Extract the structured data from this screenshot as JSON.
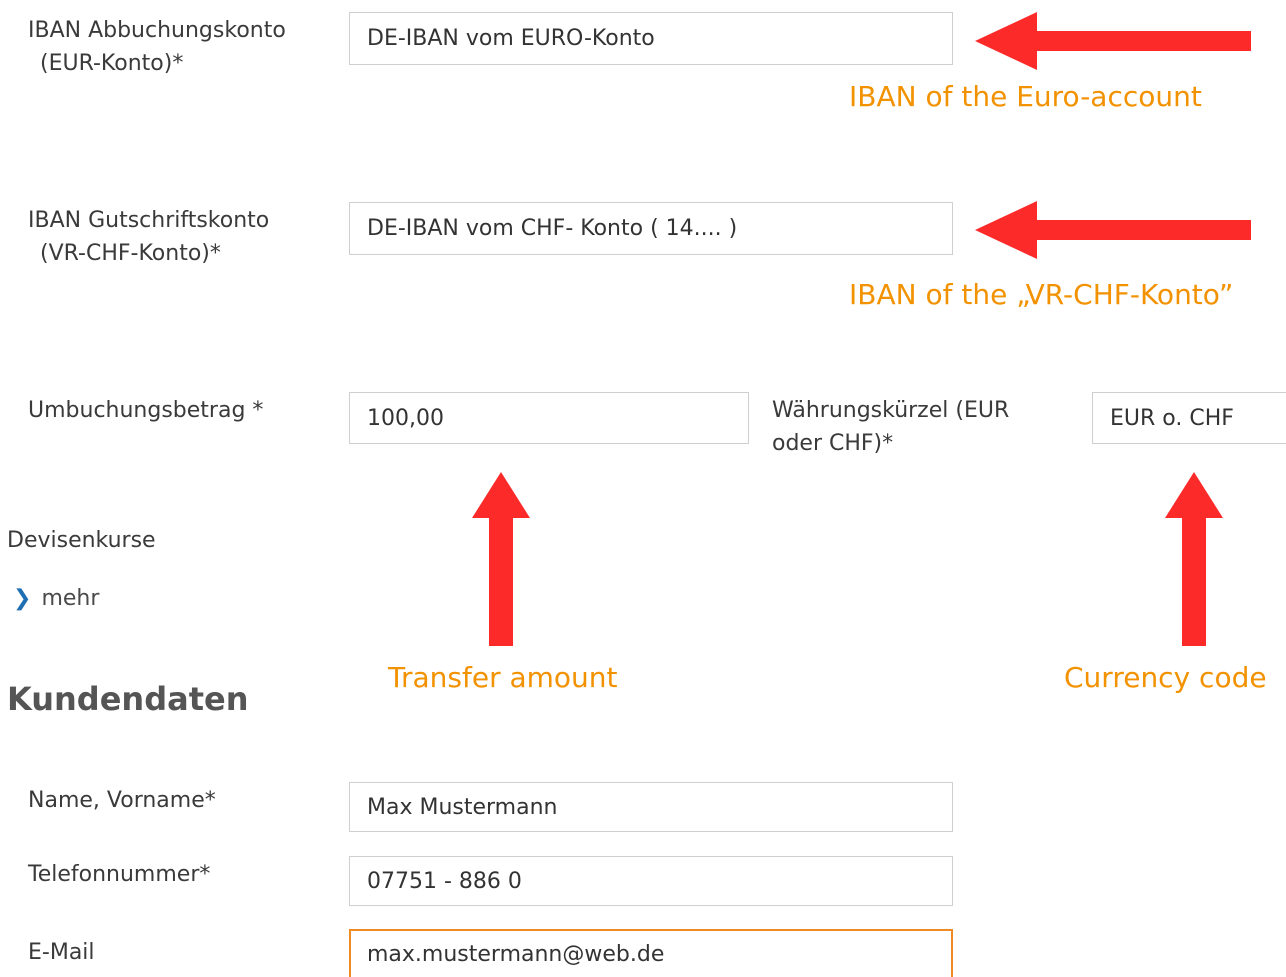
{
  "transfer": {
    "debit_label_line1": "IBAN Abbuchungskonto",
    "debit_label_line2": "(EUR-Konto)*",
    "debit_value": "DE-IBAN vom EURO-Konto",
    "credit_label_line1": "IBAN Gutschriftskonto",
    "credit_label_line2": "(VR-CHF-Konto)*",
    "credit_value": "DE-IBAN vom CHF- Konto ( 14.... )",
    "amount_label": "Umbuchungsbetrag *",
    "amount_value": "100,00",
    "currency_label_line1": "Währungskürzel (EUR",
    "currency_label_line2": "oder CHF)*",
    "currency_value": "EUR o. CHF"
  },
  "exchange": {
    "title": "Devisenkurse",
    "more_label": "mehr",
    "more_icon": "chevron-right-icon"
  },
  "customer": {
    "title": "Kundendaten",
    "name_label": "Name, Vorname*",
    "name_value": "Max Mustermann",
    "phone_label": "Telefonnummer*",
    "phone_value": "07751 - 886 0",
    "email_label": "E-Mail",
    "email_value": "max.mustermann@web.de"
  },
  "annotations": {
    "euro_account": "IBAN of the Euro-account",
    "chf_account": "IBAN of the „VR-CHF-Konto”",
    "transfer_amount": "Transfer amount",
    "currency_code": "Currency code"
  },
  "colors": {
    "annotation_text": "#f39200",
    "arrow": "#fd2a2a",
    "focus_border": "#f08a24",
    "link_chevron": "#1f6fb3"
  }
}
